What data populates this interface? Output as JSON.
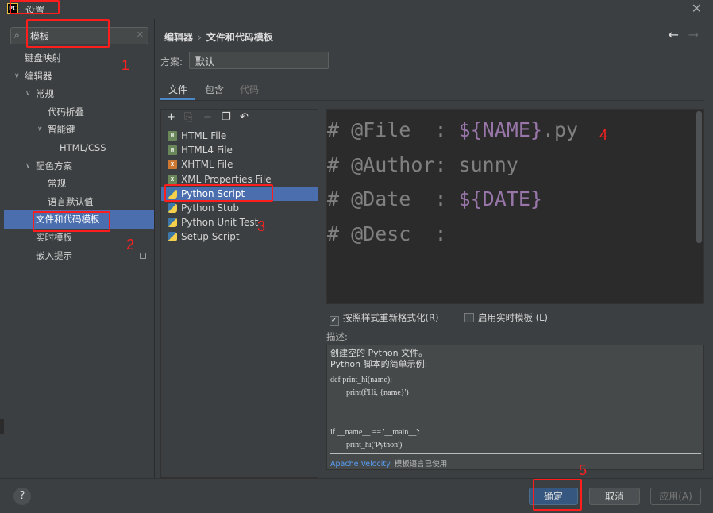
{
  "window": {
    "title": "设置",
    "app_icon": "PC"
  },
  "search": {
    "value": "模板"
  },
  "sidebar": {
    "items": [
      {
        "label": "键盘映射",
        "level": 0,
        "arrow": ""
      },
      {
        "label": "编辑器",
        "level": 0,
        "arrow": "v"
      },
      {
        "label": "常规",
        "level": 1,
        "arrow": "v"
      },
      {
        "label": "代码折叠",
        "level": 2,
        "arrow": ""
      },
      {
        "label": "智能键",
        "level": 2,
        "arrow": "v"
      },
      {
        "label": "HTML/CSS",
        "level": 3,
        "arrow": ""
      },
      {
        "label": "配色方案",
        "level": 1,
        "arrow": "v"
      },
      {
        "label": "常规",
        "level": 2,
        "arrow": ""
      },
      {
        "label": "语言默认值",
        "level": 2,
        "arrow": ""
      },
      {
        "label": "文件和代码模板",
        "level": 1,
        "arrow": "",
        "selected": true
      },
      {
        "label": "实时模板",
        "level": 1,
        "arrow": ""
      },
      {
        "label": "嵌入提示",
        "level": 1,
        "arrow": ""
      }
    ]
  },
  "header": {
    "breadcrumb_parent": "编辑器",
    "breadcrumb_sep": "›",
    "breadcrumb_current": "文件和代码模板"
  },
  "scheme": {
    "label": "方案:",
    "value": "默认"
  },
  "tabs": [
    {
      "label": "文件",
      "active": true
    },
    {
      "label": "包含"
    },
    {
      "label": "代码",
      "disabled": true
    }
  ],
  "file_list": [
    {
      "label": "HTML File",
      "icon": "html-file-icon"
    },
    {
      "label": "HTML4 File",
      "icon": "html-file-icon"
    },
    {
      "label": "XHTML File",
      "icon": "xhtml-file-icon"
    },
    {
      "label": "XML Properties File",
      "icon": "xml-file-icon"
    },
    {
      "label": "Python Script",
      "icon": "python-file-icon",
      "selected": true
    },
    {
      "label": "Python Stub",
      "icon": "python-file-icon"
    },
    {
      "label": "Python Unit Test",
      "icon": "python-file-icon"
    },
    {
      "label": "Setup Script",
      "icon": "python-file-icon"
    }
  ],
  "editor": {
    "lines": [
      {
        "prefix": "# @File  : ",
        "var": "${NAME}",
        "suffix": ".py"
      },
      {
        "prefix": "# @Author: sunny",
        "var": "",
        "suffix": ""
      },
      {
        "prefix": "# @Date  : ",
        "var": "${DATE}",
        "suffix": ""
      },
      {
        "prefix": "# @Desc  :",
        "var": "",
        "suffix": ""
      }
    ]
  },
  "options": {
    "reformat": {
      "label": "按照样式重新格式化(R)",
      "checked": true
    },
    "live_template": {
      "label": "启用实时模板 (L)",
      "checked": false
    }
  },
  "description": {
    "label": "描述:",
    "line1": "创建空的 Python 文件。",
    "line2": "Python 脚本的简单示例:",
    "code": "def print_hi(name):\n        print(f'Hi, {name}')\n\n\nif __name__ == '__main__':\n        print_hi('Python')",
    "footer_link": "Apache Velocity",
    "footer_text": "模板语言已使用"
  },
  "buttons": {
    "help": "?",
    "ok": "确定",
    "cancel": "取消",
    "apply": "应用(A)"
  },
  "annotations": {
    "n1": "1",
    "n2": "2",
    "n3": "3",
    "n4": "4",
    "n5": "5"
  },
  "colors": {
    "accent": "#4b6eaf",
    "annotation": "#ff1e1e",
    "background": "#3c3f41",
    "editor_bg": "#2b2b2b",
    "template_var": "#9876aa"
  }
}
